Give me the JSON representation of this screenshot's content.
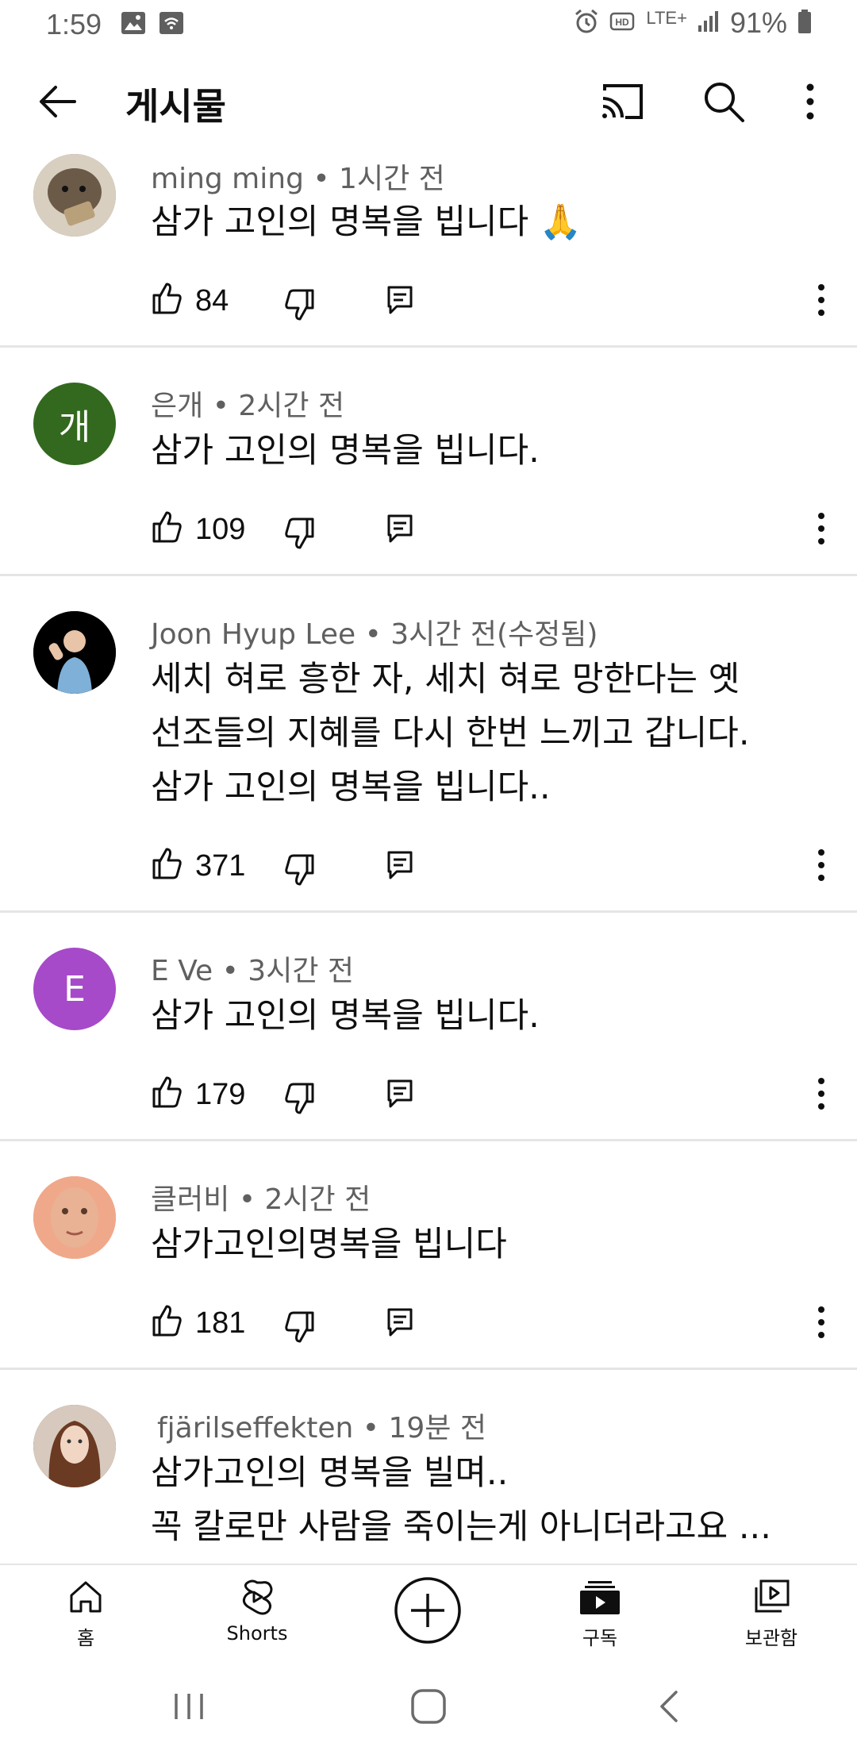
{
  "status_bar": {
    "time": "1:59",
    "network": "LTE+",
    "battery": "91%"
  },
  "app_bar": {
    "title": "게시물",
    "icons": [
      "back-arrow-icon",
      "cast-icon",
      "search-icon",
      "more-vert-icon"
    ]
  },
  "comments": [
    {
      "author": "ming ming",
      "time": "1시간 전",
      "text": "삼가 고인의 명복을 빕니다 🙏",
      "likes": "84",
      "avatar_letter": "",
      "avatar_color": "#8a7a66"
    },
    {
      "author": "은개",
      "time": "2시간 전",
      "text": "삼가 고인의 명복을 빕니다.",
      "likes": "109",
      "avatar_letter": "개",
      "avatar_color": "#33691e"
    },
    {
      "author": "Joon Hyup Lee",
      "time": "3시간 전(수정됨)",
      "text": "세치 혀로 흥한 자, 세치 혀로 망한다는 옛\n선조들의 지혜를 다시 한번 느끼고 갑니다.\n삼가 고인의 명복을 빕니다..",
      "likes": "371",
      "avatar_letter": "",
      "avatar_color": "#000000"
    },
    {
      "author": "E Ve",
      "time": "3시간 전",
      "text": "삼가 고인의 명복을 빕니다.",
      "likes": "179",
      "avatar_letter": "E",
      "avatar_color": "#a64ac9"
    },
    {
      "author": "클러비",
      "time": "2시간 전",
      "text": "삼가고인의명복을 빕니다",
      "likes": "181",
      "avatar_letter": "",
      "avatar_color": "#e89a7c"
    },
    {
      "author": "fjärilseffekten",
      "time": "19분 전",
      "text": "삼가고인의 명복을 빌며..\n꼭 칼로만 사람을 죽이는게 아니더라고요 ...",
      "likes": "",
      "avatar_letter": "",
      "avatar_color": "#6b4b3a"
    }
  ],
  "bottom_nav": {
    "home": "홈",
    "shorts": "Shorts",
    "subscriptions": "구독",
    "library": "보관함"
  },
  "colors": {
    "text": "#0f0f0f",
    "secondary_text": "#606060",
    "divider": "#e5e5e5"
  }
}
